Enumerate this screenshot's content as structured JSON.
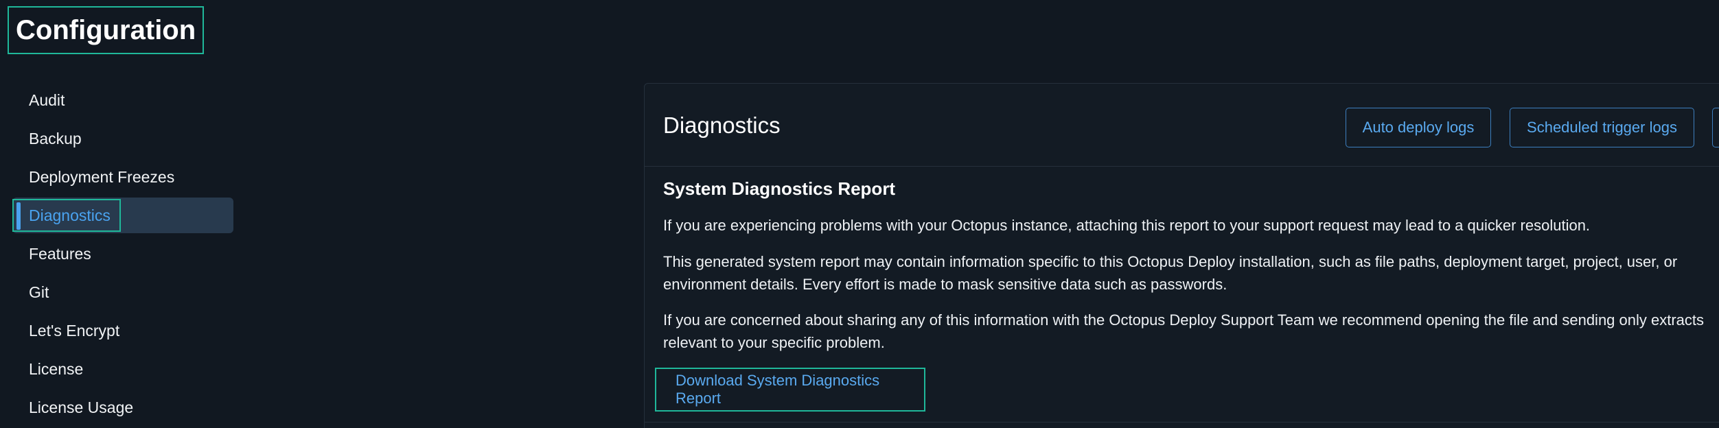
{
  "page": {
    "title": "Configuration"
  },
  "sidebar": {
    "items": [
      {
        "label": "Audit"
      },
      {
        "label": "Backup"
      },
      {
        "label": "Deployment Freezes"
      },
      {
        "label": "Diagnostics",
        "active": true
      },
      {
        "label": "Features"
      },
      {
        "label": "Git"
      },
      {
        "label": "Let's Encrypt"
      },
      {
        "label": "License"
      },
      {
        "label": "License Usage"
      }
    ]
  },
  "main": {
    "title": "Diagnostics",
    "header_buttons": {
      "auto_deploy_logs": "Auto deploy logs",
      "scheduled_trigger_logs": "Scheduled trigger logs"
    },
    "section_title": "System Diagnostics Report",
    "paragraphs": [
      "If you are experiencing problems with your Octopus instance, attaching this report to your support request may lead to a quicker resolution.",
      "This generated system report may contain information specific to this Octopus Deploy installation, such as file paths, deployment target, project, user, or environment details. Every effort is made to mask sensitive data such as passwords.",
      "If you are concerned about sharing any of this information with the Octopus Deploy Support Team we recommend opening the file and sending only extracts relevant to your specific problem."
    ],
    "download_button": "Download System Diagnostics Report"
  },
  "colors": {
    "background": "#111821",
    "accent": "#4aa3f0",
    "highlight_frame": "#1fb89a",
    "active_item_bg": "#283a4e"
  }
}
